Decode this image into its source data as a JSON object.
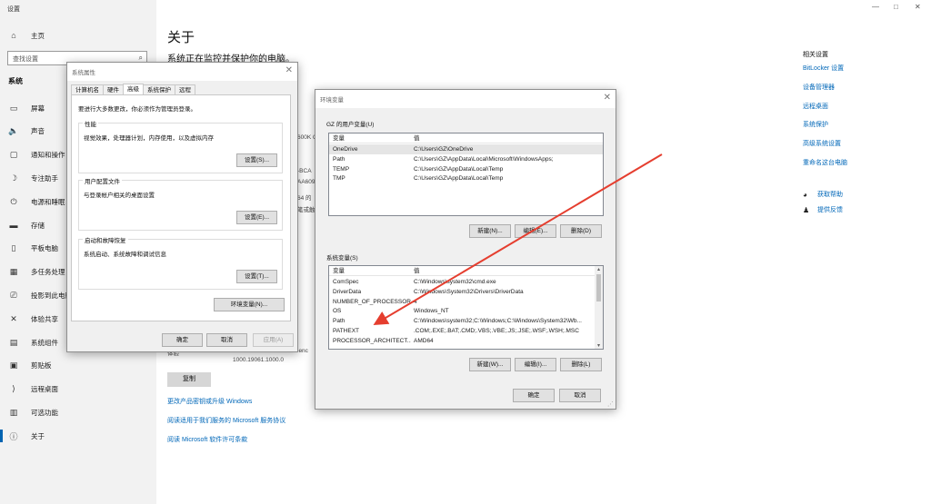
{
  "app": {
    "title": "设置"
  },
  "sidebar": {
    "home": "主页",
    "search_placeholder": "查找设置",
    "section": "系统",
    "items": [
      {
        "label": "屏幕",
        "icon": "monitor-icon"
      },
      {
        "label": "声音",
        "icon": "speaker-icon"
      },
      {
        "label": "通知和操作",
        "icon": "notification-icon"
      },
      {
        "label": "专注助手",
        "icon": "moon-icon"
      },
      {
        "label": "电源和睡眠",
        "icon": "power-icon"
      },
      {
        "label": "存储",
        "icon": "storage-icon"
      },
      {
        "label": "平板电脑",
        "icon": "tablet-icon"
      },
      {
        "label": "多任务处理",
        "icon": "multitask-icon"
      },
      {
        "label": "投影到此电脑",
        "icon": "project-icon"
      },
      {
        "label": "体验共享",
        "icon": "share-icon"
      },
      {
        "label": "系统组件",
        "icon": "components-icon"
      },
      {
        "label": "剪贴板",
        "icon": "clipboard-icon"
      },
      {
        "label": "远程桌面",
        "icon": "remote-icon"
      },
      {
        "label": "可选功能",
        "icon": "optional-features-icon"
      },
      {
        "label": "关于",
        "icon": "info-icon",
        "active": true
      }
    ]
  },
  "main": {
    "title": "关于",
    "subtitle": "系统正在监控并保护你的电脑。",
    "fragments": {
      "cpu": "600K C",
      "id": "-BCA",
      "id2": "AA609",
      "arch": "64 的",
      "pen": "笔或触",
      "label_experience": "体验",
      "version_text": "Windows Feature Experience",
      "version_suffix": "ienc",
      "pack": "1000.19061.1000.0"
    },
    "copy_button": "复制",
    "links": [
      "更改产品密钥或升级 Windows",
      "阅读适用于我们服务的 Microsoft 服务协议",
      "阅读 Microsoft 软件许可条款"
    ]
  },
  "related": {
    "title": "相关设置",
    "links": [
      "BitLocker 设置",
      "设备管理器",
      "远程桌面",
      "系统保护",
      "高级系统设置",
      "重命名这台电脑"
    ],
    "help": "获取帮助",
    "feedback": "提供反馈"
  },
  "sysprops": {
    "title": "系统属性",
    "tabs": [
      "计算机名",
      "硬件",
      "高级",
      "系统保护",
      "远程"
    ],
    "active_tab": 2,
    "note": "要进行大多数更改，你必须作为管理员登录。",
    "groups": [
      {
        "title": "性能",
        "desc": "视觉效果，处理器计划，内存使用，以及虚拟内存",
        "button": "设置(S)..."
      },
      {
        "title": "用户配置文件",
        "desc": "与登录帐户相关的桌面设置",
        "button": "设置(E)..."
      },
      {
        "title": "启动和故障恢复",
        "desc": "系统启动、系统故障和调试信息",
        "button": "设置(T)..."
      }
    ],
    "env_button": "环境变量(N)...",
    "ok": "确定",
    "cancel": "取消",
    "apply": "应用(A)"
  },
  "envvars": {
    "title": "环境变量",
    "user_section": "GZ 的用户变量(U)",
    "col_var": "变量",
    "col_val": "值",
    "user_vars": [
      {
        "name": "OneDrive",
        "value": "C:\\Users\\GZ\\OneDrive"
      },
      {
        "name": "Path",
        "value": "C:\\Users\\GZ\\AppData\\Local\\Microsoft\\WindowsApps;"
      },
      {
        "name": "TEMP",
        "value": "C:\\Users\\GZ\\AppData\\Local\\Temp"
      },
      {
        "name": "TMP",
        "value": "C:\\Users\\GZ\\AppData\\Local\\Temp"
      }
    ],
    "user_buttons": [
      "新建(N)...",
      "编辑(E)...",
      "删除(D)"
    ],
    "sys_section": "系统变量(S)",
    "sys_vars": [
      {
        "name": "ComSpec",
        "value": "C:\\Windows\\system32\\cmd.exe"
      },
      {
        "name": "DriverData",
        "value": "C:\\Windows\\System32\\Drivers\\DriverData"
      },
      {
        "name": "NUMBER_OF_PROCESSORS",
        "value": "4"
      },
      {
        "name": "OS",
        "value": "Windows_NT"
      },
      {
        "name": "Path",
        "value": "C:\\Windows\\system32;C:\\Windows;C:\\Windows\\System32\\Wb..."
      },
      {
        "name": "PATHEXT",
        "value": ".COM;.EXE;.BAT;.CMD;.VBS;.VBE;.JS;.JSE;.WSF;.WSH;.MSC"
      },
      {
        "name": "PROCESSOR_ARCHITECT...",
        "value": "AMD64"
      }
    ],
    "sys_buttons": [
      "新建(W)...",
      "编辑(I)...",
      "删除(L)"
    ],
    "ok": "确定",
    "cancel": "取消"
  },
  "colors": {
    "accent": "#0067b8",
    "arrow": "#e53e2f"
  }
}
